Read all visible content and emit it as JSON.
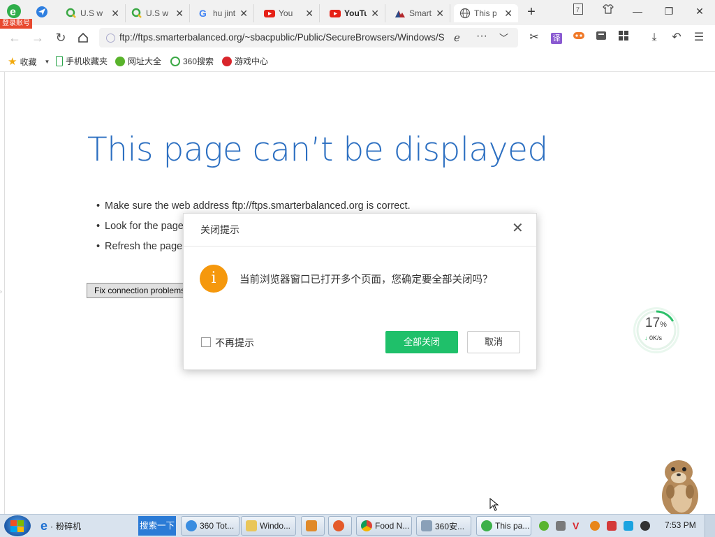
{
  "browser": {
    "login_badge": "登录账号",
    "tabs": [
      {
        "title": "U.S wa",
        "icon": "q-search-icon",
        "active": false
      },
      {
        "title": "U.S wa",
        "icon": "q-search-icon",
        "active": false
      },
      {
        "title": "hu jinta",
        "icon": "google-icon",
        "active": false
      },
      {
        "title": "You",
        "icon": "youtube-icon",
        "active": false
      },
      {
        "title": "YouTu",
        "icon": "youtube-icon",
        "active": false
      },
      {
        "title": "Smart",
        "icon": "smarter-balanced-icon",
        "active": false
      },
      {
        "title": "This p",
        "icon": "globe-icon",
        "active": true
      }
    ],
    "new_tab": "+",
    "window_controls": {
      "minimize": "—",
      "restore": "❐",
      "close": "✕"
    },
    "address": {
      "url": "ftp://ftps.smarterbalanced.org/~sbacpublic/Public/SecureBrowsers/Windows/S"
    },
    "translate_label": "译",
    "bookmarks": [
      {
        "label": "收藏",
        "icon": "star-icon"
      },
      {
        "label": "手机收藏夹",
        "icon": "phone-icon"
      },
      {
        "label": "网址大全",
        "icon": "sites-icon"
      },
      {
        "label": "360搜索",
        "icon": "search360-icon"
      },
      {
        "label": "游戏中心",
        "icon": "game-icon"
      }
    ]
  },
  "page": {
    "title": "This page can’t be displayed",
    "bullets": [
      "Make sure the web address ftp://ftps.smarterbalanced.org is correct.",
      "Look for the page",
      "Refresh the page"
    ],
    "fix_button": "Fix connection problems"
  },
  "speed_widget": {
    "percent": "17",
    "percent_sign": "%",
    "rate": "0K/s",
    "level": 0.17
  },
  "dialog": {
    "title": "关闭提示",
    "message": "当前浏览器窗口已打开多个页面，您确定要全部关闭吗？",
    "checkbox_label": "不再提示",
    "confirm": "全部关闭",
    "cancel": "取消"
  },
  "taskbar": {
    "quick_label": "粉碎机",
    "search_button": "搜索一下",
    "items": [
      {
        "label": "360 Tot...",
        "icon": "ie-icon"
      },
      {
        "label": "Windo...",
        "icon": "folder-icon"
      },
      {
        "label": "",
        "icon": "media-player-icon"
      },
      {
        "label": "",
        "icon": "app-icon"
      },
      {
        "label": "Food N...",
        "icon": "chrome-icon"
      },
      {
        "label": "360安...",
        "icon": "window-icon"
      },
      {
        "label": "This pa...",
        "icon": "browser360-icon"
      }
    ],
    "clock": "7:53 PM"
  },
  "colors": {
    "title_blue": "#2c6fc1",
    "confirm_green": "#1fc06a",
    "warning_orange": "#f5980d"
  }
}
